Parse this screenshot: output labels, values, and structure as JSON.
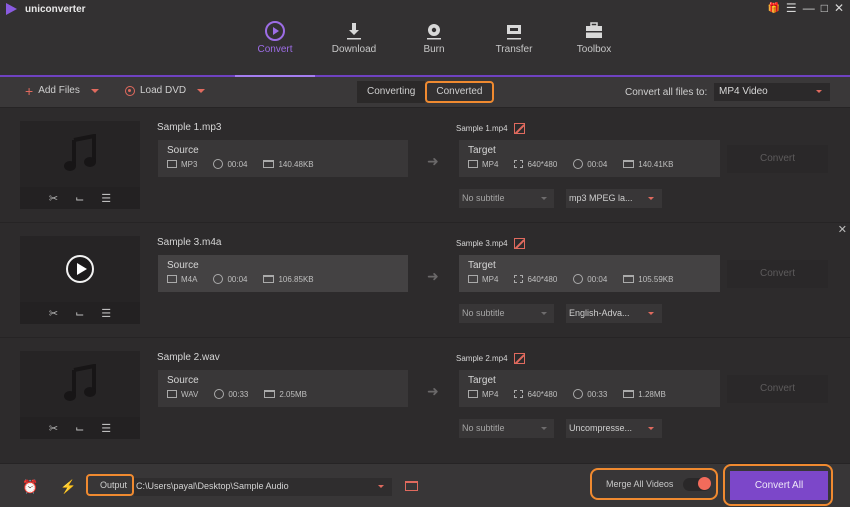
{
  "app": {
    "title": "uniconverter",
    "window_controls": [
      "gift-icon",
      "menu-icon",
      "minimize-icon",
      "maximize-icon",
      "close-icon"
    ]
  },
  "nav": {
    "items": [
      {
        "label": "Convert",
        "icon": "convert-icon",
        "active": true
      },
      {
        "label": "Download",
        "icon": "download-icon",
        "active": false
      },
      {
        "label": "Burn",
        "icon": "burn-icon",
        "active": false
      },
      {
        "label": "Transfer",
        "icon": "transfer-icon",
        "active": false
      },
      {
        "label": "Toolbox",
        "icon": "toolbox-icon",
        "active": false
      }
    ]
  },
  "toolbar": {
    "add_files": "Add Files",
    "load_dvd": "Load DVD",
    "tabs": [
      "Converting",
      "Converted"
    ],
    "convert_all_to_label": "Convert all files to:",
    "convert_all_to_value": "MP4 Video"
  },
  "files": [
    {
      "name": "Sample 1.mp3",
      "thumb": "music-note-icon",
      "source": {
        "title": "Source",
        "format": "MP3",
        "duration": "00:04",
        "size": "140.48KB"
      },
      "target_name": "Sample 1.mp4",
      "target": {
        "title": "Target",
        "format": "MP4",
        "resolution": "640*480",
        "duration": "00:04",
        "size": "140.41KB"
      },
      "subtitle": "No subtitle",
      "audio": "mp3 MPEG la...",
      "convert_label": "Convert"
    },
    {
      "name": "Sample 3.m4a",
      "thumb": "play-icon",
      "source": {
        "title": "Source",
        "format": "M4A",
        "duration": "00:04",
        "size": "106.85KB"
      },
      "target_name": "Sample 3.mp4",
      "target": {
        "title": "Target",
        "format": "MP4",
        "resolution": "640*480",
        "duration": "00:04",
        "size": "105.59KB"
      },
      "subtitle": "No subtitle",
      "audio": "English-Adva...",
      "convert_label": "Convert"
    },
    {
      "name": "Sample 2.wav",
      "thumb": "music-note-icon",
      "source": {
        "title": "Source",
        "format": "WAV",
        "duration": "00:33",
        "size": "2.05MB"
      },
      "target_name": "Sample 2.mp4",
      "target": {
        "title": "Target",
        "format": "MP4",
        "resolution": "640*480",
        "duration": "00:33",
        "size": "1.28MB"
      },
      "subtitle": "No subtitle",
      "audio": "Uncompresse...",
      "convert_label": "Convert"
    }
  ],
  "bottom": {
    "output_label": "Output",
    "output_path": "C:\\Users\\payal\\Desktop\\Sample Audio",
    "merge_label": "Merge All Videos",
    "merge_on": true,
    "convert_all": "Convert All"
  },
  "colors": {
    "accent": "#7c47c9",
    "highlight": "#f08a30",
    "icon_red": "#e06a5e"
  }
}
